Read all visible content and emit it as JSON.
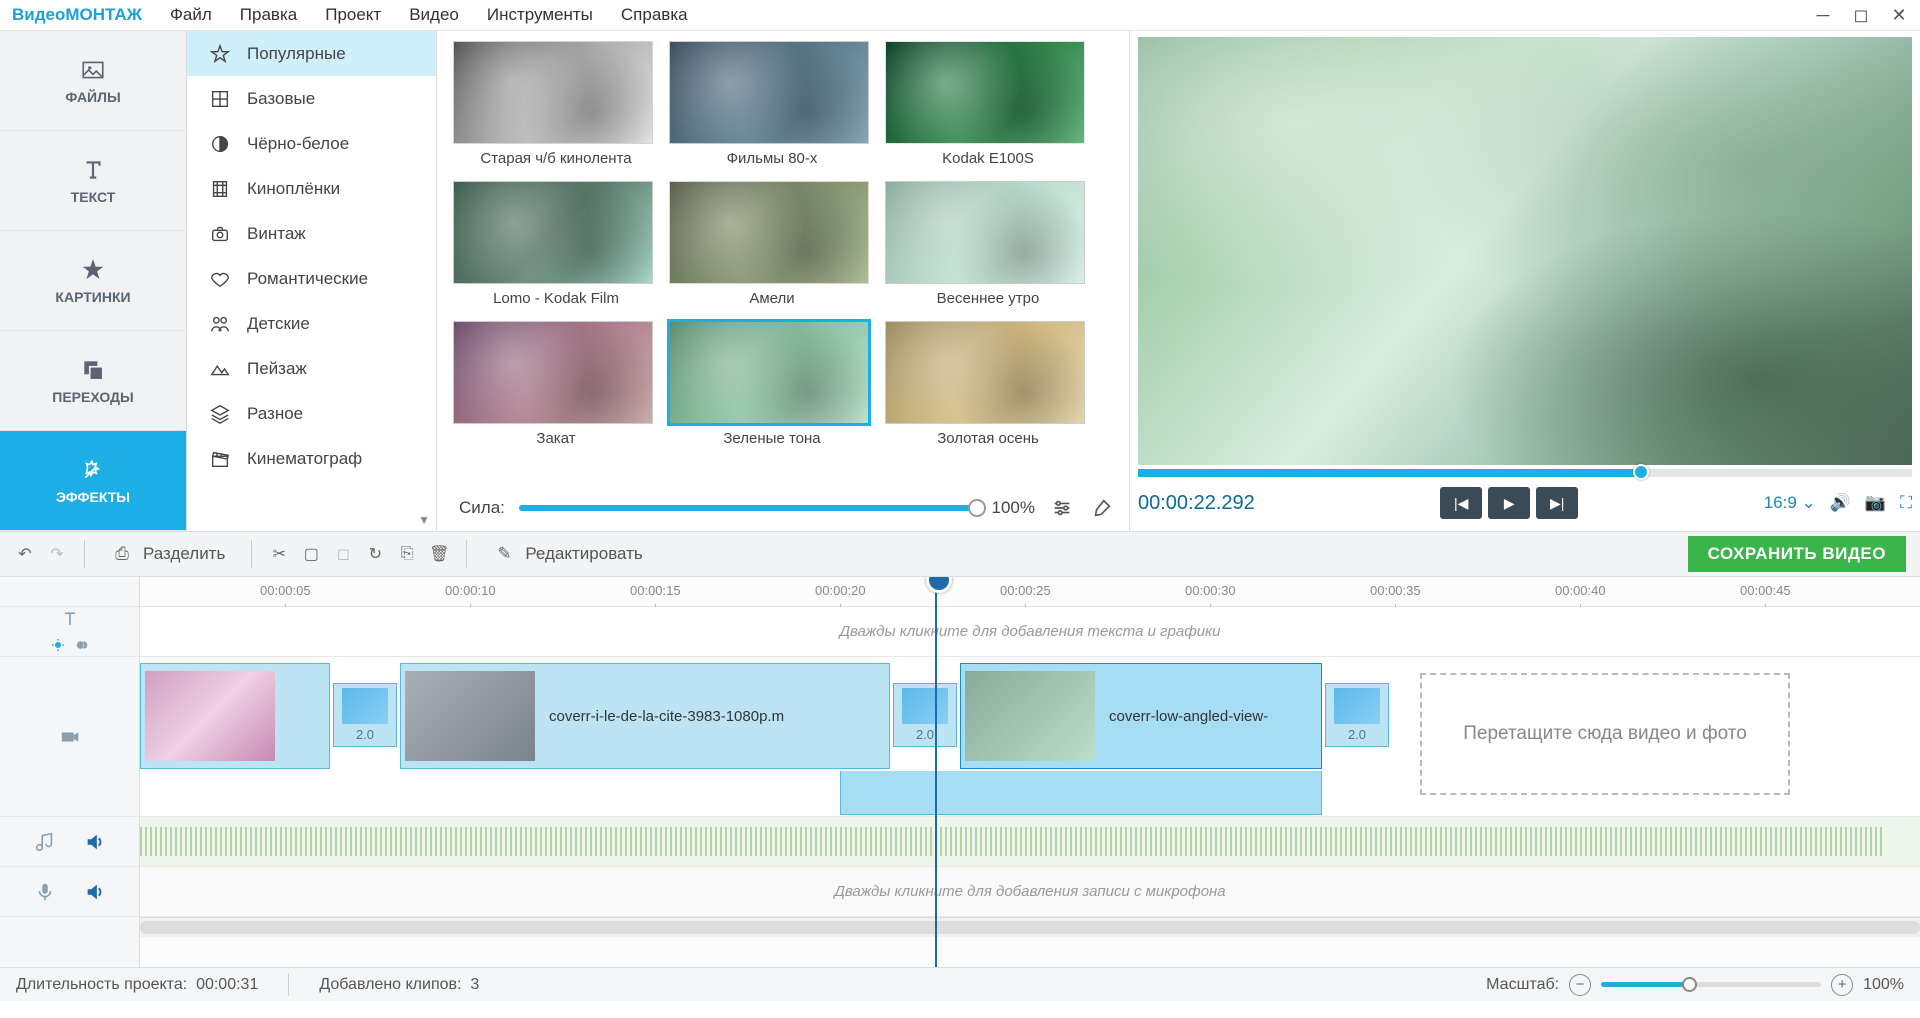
{
  "brand": {
    "pre": "Видео",
    "post": "МОНТАЖ"
  },
  "menu": [
    "Файл",
    "Правка",
    "Проект",
    "Видео",
    "Инструменты",
    "Справка"
  ],
  "sidebar": [
    {
      "label": "ФАЙЛЫ",
      "icon": "image"
    },
    {
      "label": "ТЕКСТ",
      "icon": "text"
    },
    {
      "label": "КАРТИНКИ",
      "icon": "star"
    },
    {
      "label": "ПЕРЕХОДЫ",
      "icon": "copy"
    },
    {
      "label": "ЭФФЕКТЫ",
      "icon": "wand",
      "active": true
    }
  ],
  "categories": [
    {
      "label": "Популярные",
      "active": true,
      "icon": "star"
    },
    {
      "label": "Базовые",
      "icon": "grid"
    },
    {
      "label": "Чёрно-белое",
      "icon": "contrast"
    },
    {
      "label": "Киноплёнки",
      "icon": "film"
    },
    {
      "label": "Винтаж",
      "icon": "camera"
    },
    {
      "label": "Романтические",
      "icon": "heart"
    },
    {
      "label": "Детские",
      "icon": "people"
    },
    {
      "label": "Пейзаж",
      "icon": "landscape"
    },
    {
      "label": "Разное",
      "icon": "layers"
    },
    {
      "label": "Кинематограф",
      "icon": "clapper"
    }
  ],
  "effects": [
    {
      "label": "Старая ч/б кинолента",
      "cls": "bw"
    },
    {
      "label": "Фильмы 80-х",
      "cls": "film80"
    },
    {
      "label": "Kodak E100S",
      "cls": "kodak"
    },
    {
      "label": "Lomo - Kodak Film",
      "cls": "lomo"
    },
    {
      "label": "Амели",
      "cls": "ameli"
    },
    {
      "label": "Весеннее утро",
      "cls": "spring"
    },
    {
      "label": "Закат",
      "cls": "sunset"
    },
    {
      "label": "Зеленые тона",
      "cls": "green",
      "selected": true
    },
    {
      "label": "Золотая осень",
      "cls": "autumn"
    }
  ],
  "strength": {
    "label": "Сила:",
    "value": "100%"
  },
  "preview": {
    "time": "00:00:22.292",
    "aspect": "16:9"
  },
  "toolbar": {
    "split": "Разделить",
    "edit": "Редактировать",
    "save": "СОХРАНИТЬ ВИДЕО"
  },
  "ruler": [
    "00:00:05",
    "00:00:10",
    "00:00:15",
    "00:00:20",
    "00:00:25",
    "00:00:30",
    "00:00:35",
    "00:00:40",
    "00:00:45"
  ],
  "tracks": {
    "text_hint": "Дважды кликните для добавления текста и графики",
    "mic_hint": "Дважды кликните для добавления записи с микрофона",
    "clip2_name": "coverr-i-le-de-la-cite-3983-1080p.m",
    "clip3_name": "coverr-low-angled-view-",
    "trans_dur": "2.0",
    "dropzone": "Перетащите сюда видео и фото"
  },
  "status": {
    "dur_label": "Длительность проекта:",
    "dur_val": "00:00:31",
    "clips_label": "Добавлено клипов:",
    "clips_val": "3",
    "zoom_label": "Масштаб:",
    "zoom_val": "100%"
  }
}
